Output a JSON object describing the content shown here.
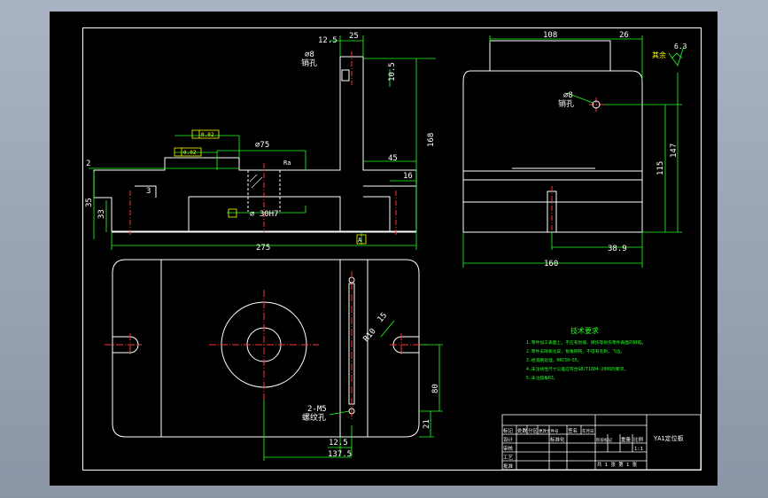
{
  "drawing": {
    "top_view": {
      "dims": [
        "12.5",
        "25",
        "10.5",
        "168",
        "45",
        "16",
        "2",
        "3",
        "35",
        "33",
        "275"
      ],
      "hole_label_dia": "⌀8",
      "hole_label_text": "销孔",
      "bore_dia": "⌀75",
      "bore_30h7": "⌀ 30H7",
      "angle_mark": "Ra",
      "tol_flat": "0.02",
      "tol_parallel": "0.02",
      "datum_a": "A"
    },
    "side_view": {
      "dims": [
        "108",
        "26",
        "147",
        "115",
        "38.9",
        "160"
      ],
      "hole_label_dia": "⌀8",
      "hole_label_text": "销孔",
      "roughness_value": "6.3",
      "roughness_text": "其余"
    },
    "plan_view": {
      "dims": [
        "2-M5",
        "80",
        "21",
        "12.5",
        "137.5"
      ],
      "thread_label": "螺纹孔",
      "slot_dims": [
        "R10",
        "15"
      ]
    },
    "notes": {
      "title": "技术要求",
      "items": [
        "1.零件加工表面上，不应有划痕、擦伤等损伤零件表面的缺陷。",
        "2.零件去除氧化皮，锐角倒钝，不得有毛刺，飞边。",
        "3.经调质处理，HRC50~55。",
        "4.未注线性尺寸公差应符合GB/T1804-2000的要求。",
        "5.未注圆角R3。"
      ]
    },
    "title_block": {
      "part_name": "YA1定位板",
      "row1": [
        "标记",
        "处数",
        "分区",
        "更改文件号",
        "签名",
        "年月日"
      ],
      "labels": [
        "设计",
        "审核",
        "工艺",
        "批准",
        "标准化"
      ],
      "stage_headers": [
        "阶段标记",
        "重量",
        "比例"
      ],
      "scale": "1:1",
      "sheet_info": "共 1 张  第 1 张"
    }
  }
}
